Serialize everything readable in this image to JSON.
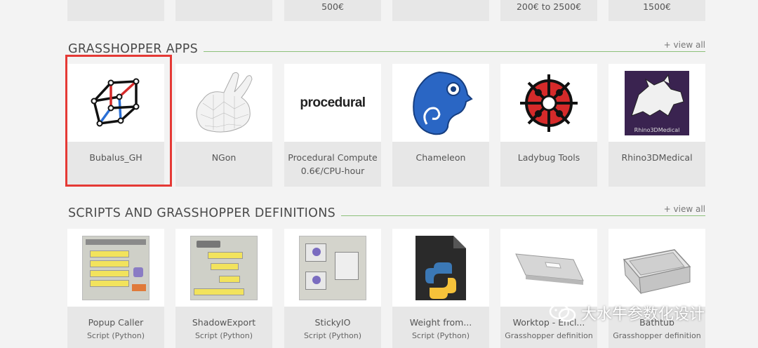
{
  "top_row": {
    "prices": [
      "",
      "",
      "500€",
      "200€ to 2500€",
      "1500€"
    ]
  },
  "apps": {
    "title": "GRASSHOPPER APPS",
    "view_all": "+ view all",
    "items": [
      {
        "name": "Bubalus_GH",
        "sub": ""
      },
      {
        "name": "NGon",
        "sub": ""
      },
      {
        "name": "Procedural Compute",
        "sub": "0.6€/CPU-hour",
        "logo_text": "procedural"
      },
      {
        "name": "Chameleon",
        "sub": ""
      },
      {
        "name": "Ladybug Tools",
        "sub": ""
      },
      {
        "name": "Rhino3DMedical",
        "sub": "",
        "logo_text": "Rhino3DMedical"
      }
    ]
  },
  "scripts": {
    "title": "SCRIPTS AND GRASSHOPPER DEFINITIONS",
    "view_all": "+ view all",
    "items": [
      {
        "name": "Popup Caller",
        "type": "Script (Python)"
      },
      {
        "name": "ShadowExport",
        "type": "Script (Python)"
      },
      {
        "name": "StickyIO",
        "type": "Script (Python)"
      },
      {
        "name": "Weight from...",
        "type": "Script (Python)"
      },
      {
        "name": "Worktop - Encl...",
        "type": "Grasshopper definition"
      },
      {
        "name": "Bathtub",
        "type": "Grasshopper definition"
      }
    ]
  },
  "watermark": {
    "text": "大水牛参数化设计"
  },
  "colors": {
    "highlight": "#e53935",
    "rule": "#8dc07a",
    "card_bg": "#e7e7e7"
  }
}
